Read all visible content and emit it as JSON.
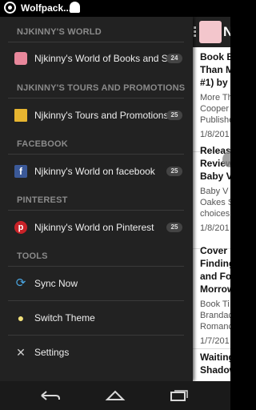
{
  "status": {
    "notification_text": "Wolfpack....",
    "icons": [
      "whatsapp-icon",
      "ghost-icon"
    ]
  },
  "drawer": {
    "sections": [
      {
        "header": "NJKINNY'S WORLD",
        "items": [
          {
            "label": "Njkinny's World of Books and Stuff",
            "count": "24",
            "icon": "blog-logo-icon"
          }
        ]
      },
      {
        "header": "NJKINNY'S TOURS AND PROMOTIONS",
        "items": [
          {
            "label": "Njkinny's Tours and Promotions",
            "count": "25",
            "icon": "tours-logo-icon"
          }
        ]
      },
      {
        "header": "FACEBOOK",
        "items": [
          {
            "label": "Njkinny's World on facebook",
            "count": "25",
            "icon": "facebook-icon"
          }
        ]
      },
      {
        "header": "PINTEREST",
        "items": [
          {
            "label": "Njkinny's World on Pinterest",
            "count": "25",
            "icon": "pinterest-icon"
          }
        ]
      },
      {
        "header": "TOOLS",
        "items": [
          {
            "label": "Sync Now",
            "icon": "sync-icon"
          },
          {
            "label": "Switch Theme",
            "icon": "lightbulb-icon"
          },
          {
            "label": "Settings",
            "icon": "settings-icon"
          }
        ]
      }
    ]
  },
  "content": {
    "title_letter": "N",
    "articles": [
      {
        "title_lines": [
          "Book B",
          "Than M",
          "#1) by"
        ],
        "snippet_lines": [
          "More Th",
          "Cooper",
          "Publishe"
        ],
        "date": "1/8/201"
      },
      {
        "title_lines": [
          "Releas",
          "Review",
          "Baby V"
        ],
        "snippet_lines": [
          "Baby V",
          "Oakes S",
          "choices"
        ],
        "date": "1/8/201"
      },
      {
        "title_lines": [
          "Cover R",
          "Finding",
          "and Fo",
          "Morrow"
        ],
        "snippet_lines": [
          "Book Ti",
          "Brandac",
          "Romanc"
        ],
        "date": "1/7/201"
      },
      {
        "title_lines": [
          "Waiting",
          "Shadow"
        ],
        "snippet_lines": [],
        "date": ""
      }
    ]
  },
  "navbar": {
    "buttons": [
      "back-icon",
      "home-icon",
      "recent-apps-icon"
    ]
  },
  "colors": {
    "drawer_bg": "#222222",
    "header_text": "#8a8a8a",
    "facebook": "#3b5998",
    "pinterest": "#c92228"
  }
}
